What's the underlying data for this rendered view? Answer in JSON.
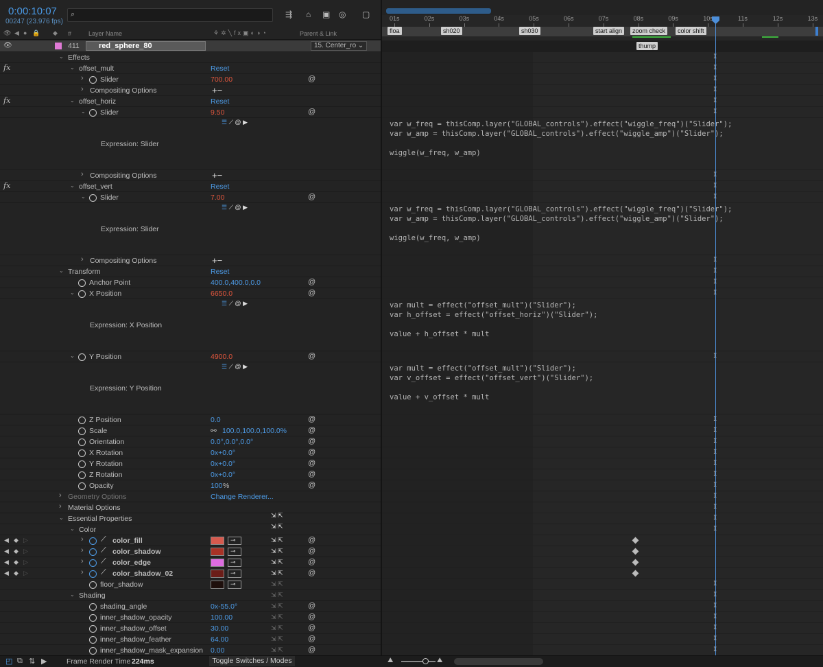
{
  "header": {
    "timecode": "0:00:10:07",
    "frame_fps": "00247 (23.976 fps)",
    "search_placeholder": "",
    "col_layer_name": "Layer Name",
    "col_parent_link": "Parent & Link",
    "col_hash": "#"
  },
  "layer": {
    "number": "411",
    "name": "red_sphere_80",
    "parent": "15. Center_ro"
  },
  "rows": {
    "effects": "Effects",
    "offset_mult": "offset_mult",
    "reset": "Reset",
    "slider": "Slider",
    "slider_mult_val": "700.00",
    "compositing_options": "Compositing Options",
    "offset_horiz": "offset_horiz",
    "slider_horiz_val": "9.50",
    "expression_slider": "Expression: Slider",
    "offset_vert": "offset_vert",
    "slider_vert_val": "7.00",
    "transform": "Transform",
    "anchor_point": "Anchor Point",
    "anchor_val": "400.0,400.0,0.0",
    "x_position": "X Position",
    "x_position_val": "6650.0",
    "expression_x": "Expression: X Position",
    "y_position": "Y Position",
    "y_position_val": "4900.0",
    "expression_y": "Expression: Y Position",
    "z_position": "Z Position",
    "z_position_val": "0.0",
    "scale": "Scale",
    "scale_val": "100.0,100.0,100.0%",
    "orientation": "Orientation",
    "orientation_val": "0.0°,0.0°,0.0°",
    "x_rotation": "X Rotation",
    "x_rotation_val": "0x+0.0°",
    "y_rotation": "Y Rotation",
    "y_rotation_val": "0x+0.0°",
    "z_rotation": "Z Rotation",
    "z_rotation_val": "0x+0.0°",
    "opacity": "Opacity",
    "opacity_val": "100",
    "opacity_unit": "%",
    "geometry_options": "Geometry Options",
    "change_renderer": "Change Renderer...",
    "material_options": "Material Options",
    "essential_properties": "Essential Properties",
    "color": "Color",
    "color_fill": "color_fill",
    "color_shadow": "color_shadow",
    "color_edge": "color_edge",
    "color_shadow_02": "color_shadow_02",
    "floor_shadow": "floor_shadow",
    "shading": "Shading",
    "shading_angle": "shading_angle",
    "shading_angle_val": "0x-55.0°",
    "inner_shadow_opacity": "inner_shadow_opacity",
    "inner_shadow_opacity_val": "100.00",
    "inner_shadow_offset": "inner_shadow_offset",
    "inner_shadow_offset_val": "30.00",
    "inner_shadow_feather": "inner_shadow_feather",
    "inner_shadow_feather_val": "64.00",
    "inner_shadow_mask_expansion": "inner_shadow_mask_expansion",
    "inner_shadow_mask_expansion_val": "0.00"
  },
  "swatches": {
    "color_fill": "#d65a4e",
    "color_shadow": "#a83226",
    "color_edge": "#dd6ce0",
    "color_shadow_02": "#6b1d18",
    "floor_shadow": "#1e0f0c"
  },
  "expressions": {
    "horiz": "var w_freq = thisComp.layer(\"GLOBAL_controls\").effect(\"wiggle_freq\")(\"Slider\");\nvar w_amp = thisComp.layer(\"GLOBAL_controls\").effect(\"wiggle_amp\")(\"Slider\");\n\nwiggle(w_freq, w_amp)",
    "vert": "var w_freq = thisComp.layer(\"GLOBAL_controls\").effect(\"wiggle_freq\")(\"Slider\");\nvar w_amp = thisComp.layer(\"GLOBAL_controls\").effect(\"wiggle_amp\")(\"Slider\");\n\nwiggle(w_freq, w_amp)",
    "x": "var mult = effect(\"offset_mult\")(\"Slider\");\nvar h_offset = effect(\"offset_horiz\")(\"Slider\");\n\nvalue + h_offset * mult",
    "y": "var mult = effect(\"offset_mult\")(\"Slider\");\nvar v_offset = effect(\"offset_vert\")(\"Slider\");\n\nvalue + v_offset * mult"
  },
  "timeline": {
    "ticks": [
      "01s",
      "02s",
      "03s",
      "04s",
      "05s",
      "06s",
      "07s",
      "08s",
      "09s",
      "10s",
      "11s",
      "12s",
      "13s"
    ],
    "markers": [
      "floa",
      "sh020",
      "sh030",
      "start align",
      "zoom check",
      "color shift"
    ],
    "layer_marker": "thump"
  },
  "footer": {
    "frame_render_label": "Frame Render Time",
    "frame_render_value": "224ms",
    "toggle_label": "Toggle Switches / Modes"
  }
}
